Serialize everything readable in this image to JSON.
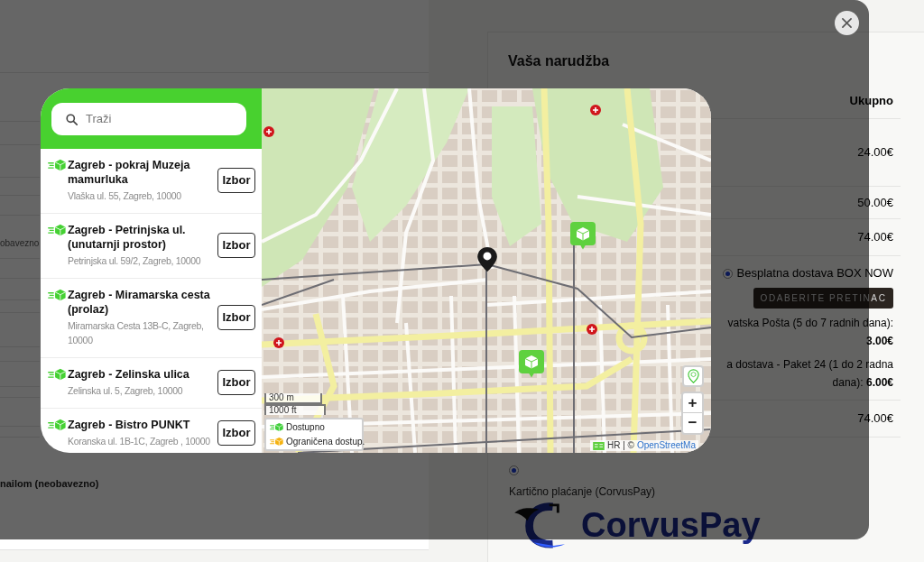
{
  "checkout_form": {
    "field_label_fragment": "obavezno",
    "email_label": "nailom (neobavezno)"
  },
  "order_summary": {
    "title": "Vaša narudžba",
    "column_heading": "Ukupno",
    "amounts": [
      "24.00€",
      "50.00€",
      "74.00€"
    ],
    "shipping": {
      "box_now": {
        "label": "Besplatna dostava BOX NOW",
        "selected": true,
        "button": "ODABERITE PRETINAC"
      },
      "other_options": [
        {
          "label": "vatska Pošta (5 do 7 radnih dana):",
          "price": "3.00€"
        },
        {
          "label": "a dostava - Paket 24 (1 do 2 radna dana):",
          "price": "6.00€"
        }
      ]
    },
    "total": "74.00€"
  },
  "payment": {
    "selected": true,
    "label": "Kartično plaćanje (CorvusPay)",
    "logo_text": "CorvusPay"
  },
  "pickup_modal": {
    "search": {
      "placeholder": "Traži"
    },
    "lockers": [
      {
        "name": "Zagreb - pokraj Muzeja mamurluka",
        "address": "Vlaška ul. 55, Zagreb, 10000",
        "button": "Izbor"
      },
      {
        "name": "Zagreb - Petrinjska ul. (unutarnji prostor)",
        "address": "Petrinjska ul. 59/2, Zagreb, 10000",
        "button": "Izbor"
      },
      {
        "name": "Zagreb - Miramarska cesta (prolaz)",
        "address": "Miramarska Cesta 13B-C, Zagreb, 10000",
        "button": "Izbor"
      },
      {
        "name": "Zagreb - Zelinska ulica",
        "address": "Zelinska ul. 5, Zagreb, 10000",
        "button": "Izbor"
      },
      {
        "name": "Zagreb - Bistro PUNKT",
        "address": "Koranska ul. 1B-1C, Zagreb , 10000",
        "button": "Izbor"
      }
    ],
    "map": {
      "scale": [
        "300 m",
        "1000 ft"
      ],
      "legend": [
        {
          "label": "Dostupno",
          "color": "#3fcf3a"
        },
        {
          "label": "Ograničena dostup.",
          "color": "#f5b20f"
        }
      ],
      "zoom_in": "+",
      "zoom_out": "−",
      "attribution": {
        "text": "HR | ©",
        "link": "OpenStreetMa"
      }
    }
  }
}
